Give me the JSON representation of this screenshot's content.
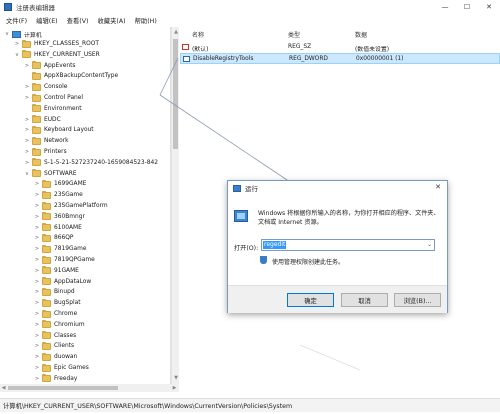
{
  "window": {
    "title": "注册表编辑器",
    "controls": [
      "—",
      "☐",
      "✕"
    ]
  },
  "menubar": [
    "文件(F)",
    "编辑(E)",
    "查看(V)",
    "收藏夹(A)",
    "帮助(H)"
  ],
  "tree": {
    "root": "计算机",
    "items": [
      {
        "label": "HKEY_CLASSES_ROOT",
        "expander": ">"
      },
      {
        "label": "HKEY_CURRENT_USER",
        "expander": "v"
      },
      {
        "label": "AppEvents",
        "expander": ">"
      },
      {
        "label": "AppXBackupContentType",
        "expander": ""
      },
      {
        "label": "Console",
        "expander": ">"
      },
      {
        "label": "Control Panel",
        "expander": ">"
      },
      {
        "label": "Environment",
        "expander": ""
      },
      {
        "label": "EUDC",
        "expander": ">"
      },
      {
        "label": "Keyboard Layout",
        "expander": ">"
      },
      {
        "label": "Network",
        "expander": ">"
      },
      {
        "label": "Printers",
        "expander": ">"
      },
      {
        "label": "S-1-5-21-527237240-1659084523-842",
        "expander": ">"
      },
      {
        "label": "SOFTWARE",
        "expander": "v"
      },
      {
        "label": "1699GAME",
        "expander": ">"
      },
      {
        "label": "23SGame",
        "expander": ">"
      },
      {
        "label": "23SGamePlatform",
        "expander": ">"
      },
      {
        "label": "360Bmngr",
        "expander": ">"
      },
      {
        "label": "6100AME",
        "expander": ">"
      },
      {
        "label": "866QP",
        "expander": ">"
      },
      {
        "label": "7819Game",
        "expander": ">"
      },
      {
        "label": "7819QPGame",
        "expander": ">"
      },
      {
        "label": "91GAME",
        "expander": ">"
      },
      {
        "label": "AppDataLow",
        "expander": ">"
      },
      {
        "label": "Binupd",
        "expander": ">"
      },
      {
        "label": "BugSplat",
        "expander": ">"
      },
      {
        "label": "Chrome",
        "expander": ">"
      },
      {
        "label": "Chromium",
        "expander": ">"
      },
      {
        "label": "Classes",
        "expander": ">"
      },
      {
        "label": "Clients",
        "expander": ">"
      },
      {
        "label": "duowan",
        "expander": ">"
      },
      {
        "label": "Epic Games",
        "expander": ">"
      },
      {
        "label": "Freeday",
        "expander": ">"
      }
    ]
  },
  "list": {
    "headers": {
      "name": "名称",
      "type": "类型",
      "data": "数据"
    },
    "rows": [
      {
        "name": "(默认)",
        "type": "REG_SZ",
        "data": "(数值未设置)",
        "icon": "string-value-icon"
      },
      {
        "name": "DisableRegistryTools",
        "type": "REG_DWORD",
        "data": "0x00000001 (1)",
        "icon": "dword-value-icon"
      }
    ]
  },
  "statusbar": "计算机\\HKEY_CURRENT_USER\\SOFTWARE\\Microsoft\\Windows\\CurrentVersion\\Policies\\System",
  "run_dialog": {
    "title": "运行",
    "description": "Windows 将根据你所输入的名称，为你打开相应的程序、文件夹、文档或 Internet 资源。",
    "open_label": "打开(O):",
    "input_value": "regedit",
    "admin_note": "使用管理权限创建此任务。",
    "buttons": {
      "ok": "确定",
      "cancel": "取消",
      "browse": "浏览(B)..."
    }
  }
}
